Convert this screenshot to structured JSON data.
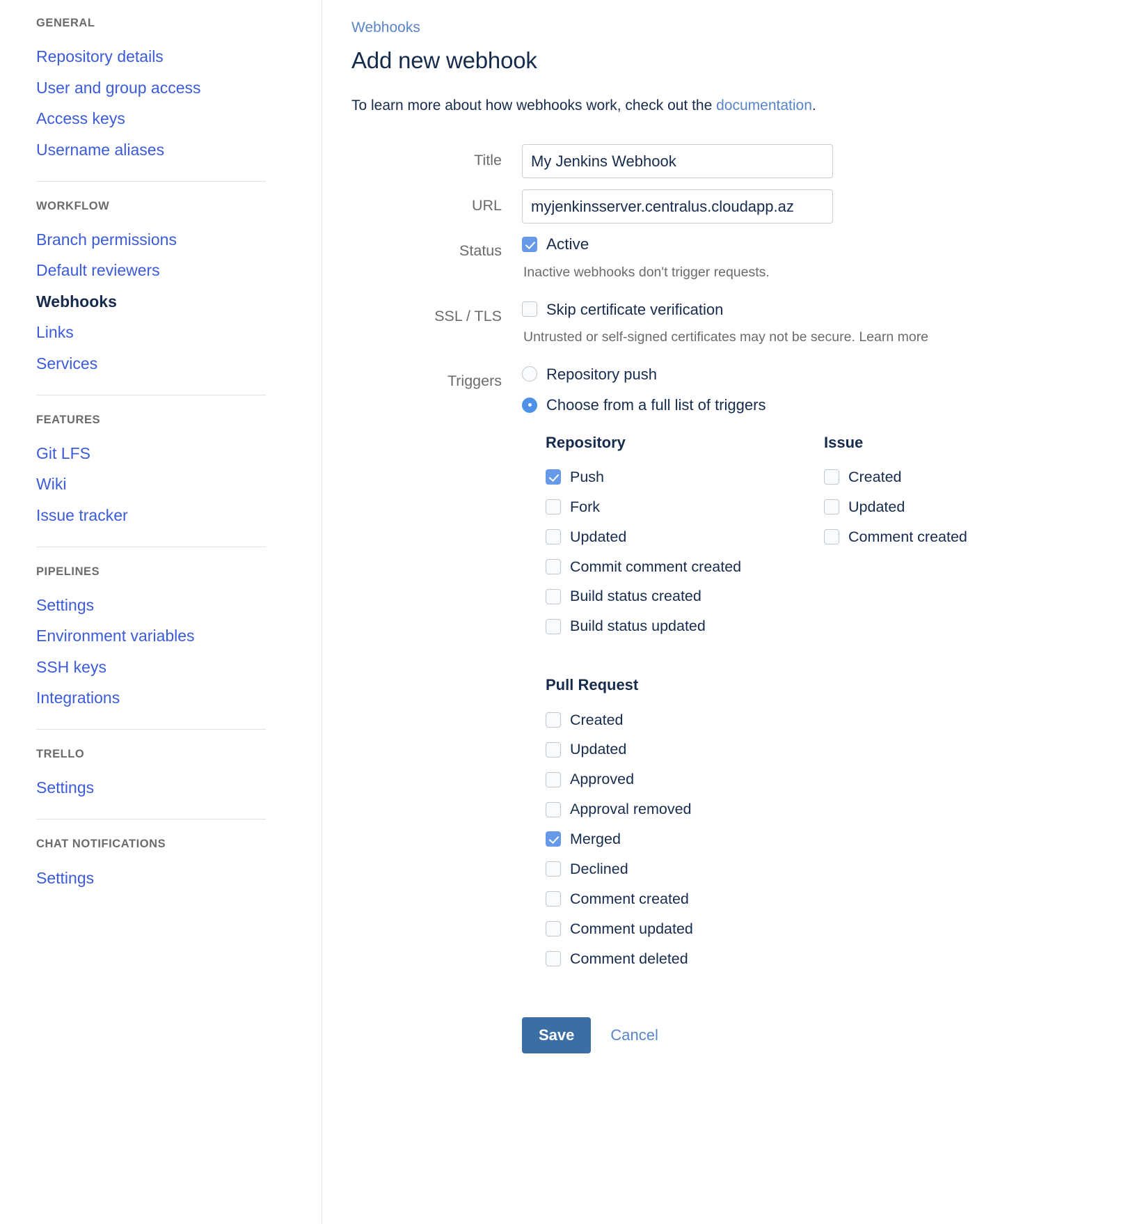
{
  "sidebar": {
    "sections": [
      {
        "title": "GENERAL",
        "items": [
          {
            "label": "Repository details",
            "active": false
          },
          {
            "label": "User and group access",
            "active": false
          },
          {
            "label": "Access keys",
            "active": false
          },
          {
            "label": "Username aliases",
            "active": false
          }
        ]
      },
      {
        "title": "WORKFLOW",
        "items": [
          {
            "label": "Branch permissions",
            "active": false
          },
          {
            "label": "Default reviewers",
            "active": false
          },
          {
            "label": "Webhooks",
            "active": true
          },
          {
            "label": "Links",
            "active": false
          },
          {
            "label": "Services",
            "active": false
          }
        ]
      },
      {
        "title": "FEATURES",
        "items": [
          {
            "label": "Git LFS",
            "active": false
          },
          {
            "label": "Wiki",
            "active": false
          },
          {
            "label": "Issue tracker",
            "active": false
          }
        ]
      },
      {
        "title": "PIPELINES",
        "items": [
          {
            "label": "Settings",
            "active": false
          },
          {
            "label": "Environment variables",
            "active": false
          },
          {
            "label": "SSH keys",
            "active": false
          },
          {
            "label": "Integrations",
            "active": false
          }
        ]
      },
      {
        "title": "TRELLO",
        "items": [
          {
            "label": "Settings",
            "active": false
          }
        ]
      },
      {
        "title": "CHAT NOTIFICATIONS",
        "items": [
          {
            "label": "Settings",
            "active": false
          }
        ]
      }
    ]
  },
  "main": {
    "breadcrumb": "Webhooks",
    "page_title": "Add new webhook",
    "intro_before": "To learn more about how webhooks work, check out the ",
    "intro_link": "documentation",
    "intro_after": ".",
    "fields": {
      "title_label": "Title",
      "title_value": "My Jenkins Webhook",
      "url_label": "URL",
      "url_value": "myjenkinsserver.centralus.cloudapp.az",
      "status_label": "Status",
      "status_checkbox_label": "Active",
      "status_checked": true,
      "status_hint": "Inactive webhooks don't trigger requests.",
      "ssl_label": "SSL / TLS",
      "ssl_checkbox_label": "Skip certificate verification",
      "ssl_checked": false,
      "ssl_hint": "Untrusted or self-signed certificates may not be secure.",
      "ssl_hint_link": "Learn more",
      "triggers_label": "Triggers",
      "trigger_radio_1": "Repository push",
      "trigger_radio_2": "Choose from a full list of triggers",
      "selected_trigger": 2
    },
    "trigger_groups_left": [
      {
        "title": "Repository",
        "items": [
          {
            "label": "Push",
            "checked": true
          },
          {
            "label": "Fork",
            "checked": false
          },
          {
            "label": "Updated",
            "checked": false
          },
          {
            "label": "Commit comment created",
            "checked": false
          },
          {
            "label": "Build status created",
            "checked": false
          },
          {
            "label": "Build status updated",
            "checked": false
          }
        ]
      },
      {
        "title": "Pull Request",
        "items": [
          {
            "label": "Created",
            "checked": false
          },
          {
            "label": "Updated",
            "checked": false
          },
          {
            "label": "Approved",
            "checked": false
          },
          {
            "label": "Approval removed",
            "checked": false
          },
          {
            "label": "Merged",
            "checked": true
          },
          {
            "label": "Declined",
            "checked": false
          },
          {
            "label": "Comment created",
            "checked": false
          },
          {
            "label": "Comment updated",
            "checked": false
          },
          {
            "label": "Comment deleted",
            "checked": false
          }
        ]
      }
    ],
    "trigger_groups_right": [
      {
        "title": "Issue",
        "items": [
          {
            "label": "Created",
            "checked": false
          },
          {
            "label": "Updated",
            "checked": false
          },
          {
            "label": "Comment created",
            "checked": false
          }
        ]
      }
    ],
    "actions": {
      "save_label": "Save",
      "cancel_label": "Cancel"
    }
  },
  "colors": {
    "link": "#3b5bdb",
    "breadcrumb_link": "#5884c8",
    "accent_checkbox": "#6699e8",
    "accent_radio": "#4d90e8",
    "primary_button": "#3b6ea5"
  }
}
